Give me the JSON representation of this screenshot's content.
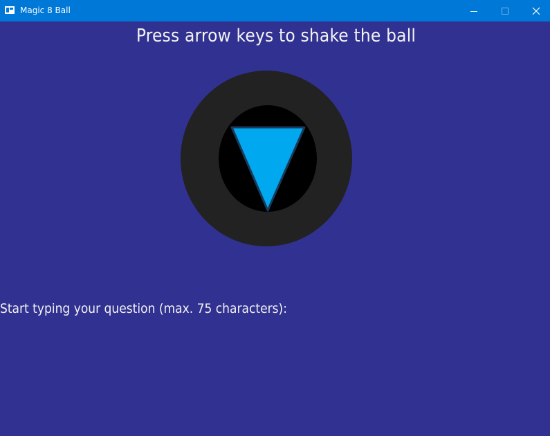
{
  "window": {
    "title": "Magic 8 Ball",
    "titlebar_color": "#0078d7",
    "background_color": "#313192"
  },
  "controls": {
    "minimize_icon": "minimize-icon",
    "maximize_icon": "maximize-icon",
    "close_icon": "close-icon"
  },
  "game": {
    "instruction": "Press arrow keys to shake the ball",
    "prompt": "Start typing your question (max. 75 characters):",
    "ball_outer_color": "#222222",
    "ball_window_color": "#000000",
    "triangle_color": "#00a8f0"
  }
}
